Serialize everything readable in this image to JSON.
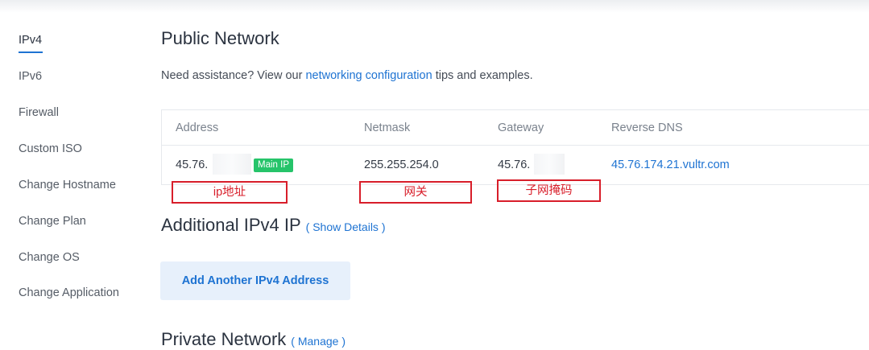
{
  "sidebar": {
    "items": [
      {
        "label": "IPv4",
        "active": true
      },
      {
        "label": "IPv6",
        "active": false
      },
      {
        "label": "Firewall",
        "active": false
      },
      {
        "label": "Custom ISO",
        "active": false
      },
      {
        "label": "Change Hostname",
        "active": false
      },
      {
        "label": "Change Plan",
        "active": false
      },
      {
        "label": "Change OS",
        "active": false
      },
      {
        "label": "Change Application",
        "active": false
      }
    ]
  },
  "public_network": {
    "title": "Public Network",
    "assist_prefix": "Need assistance? View our ",
    "assist_link": "networking configuration",
    "assist_suffix": " tips and examples.",
    "table": {
      "headers": [
        "Address",
        "Netmask",
        "Gateway",
        "Reverse DNS"
      ],
      "row": {
        "address": "45.76.",
        "main_ip_badge": "Main IP",
        "netmask": "255.255.254.0",
        "gateway": "45.76.",
        "reverse_dns": "45.76.174.21.vultr.com"
      }
    }
  },
  "annotations": {
    "address_note": "ip地址",
    "netmask_note": "网关",
    "gateway_note": "子网掩码",
    "color": "#d81e2a"
  },
  "additional_ipv4": {
    "title": "Additional IPv4 IP",
    "link": "( Show Details )",
    "add_button": "Add Another IPv4 Address"
  },
  "private_network": {
    "title": "Private Network",
    "link": "( Manage )"
  },
  "colors": {
    "accent": "#1e73d2",
    "badge": "#26c46a",
    "button_bg": "#e7f0fb"
  }
}
